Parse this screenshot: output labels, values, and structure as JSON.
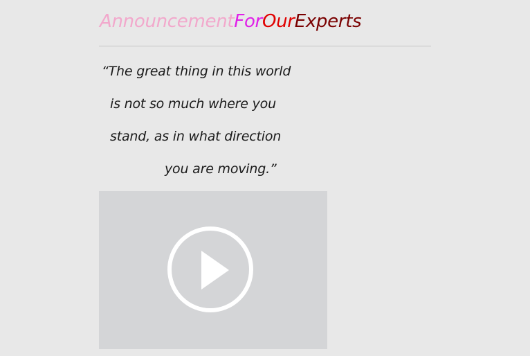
{
  "header": {
    "title_parts": [
      "Announcement",
      "For",
      "Our",
      "Experts"
    ]
  },
  "quote": {
    "lines": [
      "“The great thing in this world",
      "is not so much where you",
      "stand, as in what direction",
      "you are moving.”"
    ]
  },
  "video": {
    "icon": "play-icon"
  },
  "colors": {
    "background": "#e8e8e8",
    "title_announcement": "#f2a8cc",
    "title_for": "#e020e8",
    "title_our": "#e00000",
    "title_experts": "#7a0000",
    "video_background": "#d4d5d7"
  }
}
